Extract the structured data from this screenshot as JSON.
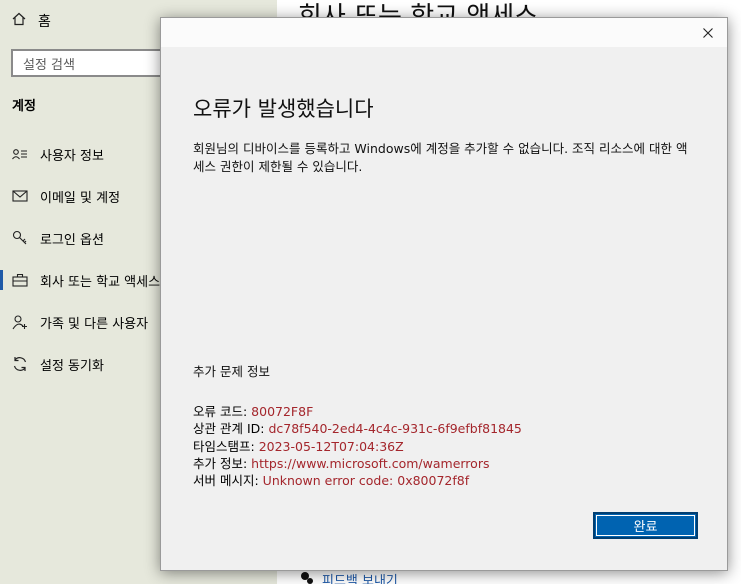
{
  "settings": {
    "home_label": "홈",
    "search_placeholder": "설정 검색",
    "section_title": "계정",
    "nav_items": [
      {
        "label": "사용자 정보",
        "icon": "user-info-icon"
      },
      {
        "label": "이메일 및 계정",
        "icon": "mail-icon"
      },
      {
        "label": "로그인 옵션",
        "icon": "key-icon"
      },
      {
        "label": "회사 또는 학교 액세스",
        "icon": "briefcase-icon"
      },
      {
        "label": "가족 및 다른 사용자",
        "icon": "person-add-icon"
      },
      {
        "label": "설정 동기화",
        "icon": "sync-icon"
      }
    ],
    "active_nav": "회사 또는 학교 액세스",
    "page_heading": "회사 또는 학교 액세스",
    "feedback_label": "피드백 보내기"
  },
  "dialog": {
    "title": "오류가 발생했습니다",
    "message": "회원님의 디바이스를 등록하고 Windows에 계정을 추가할 수 없습니다. 조직 리소스에 대한 액세스 권한이 제한될 수 있습니다.",
    "extra_info_title": "추가 문제 정보",
    "details": [
      {
        "label": "오류 코드: ",
        "value": "80072F8F"
      },
      {
        "label": "상관 관계 ID: ",
        "value": "dc78f540-2ed4-4c4c-931c-6f9efbf81845"
      },
      {
        "label": "타임스탬프: ",
        "value": "2023-05-12T07:04:36Z"
      },
      {
        "label": "추가 정보: ",
        "value": "https://www.microsoft.com/wamerrors"
      },
      {
        "label": "서버 메시지: ",
        "value": "Unknown error code: 0x80072f8f"
      }
    ],
    "ok_label": "완료"
  },
  "colors": {
    "accent": "#0063b1",
    "error_value": "#a4262c",
    "sidebar_bg": "#e6e8dc",
    "dialog_bg": "#f0f0f0"
  }
}
